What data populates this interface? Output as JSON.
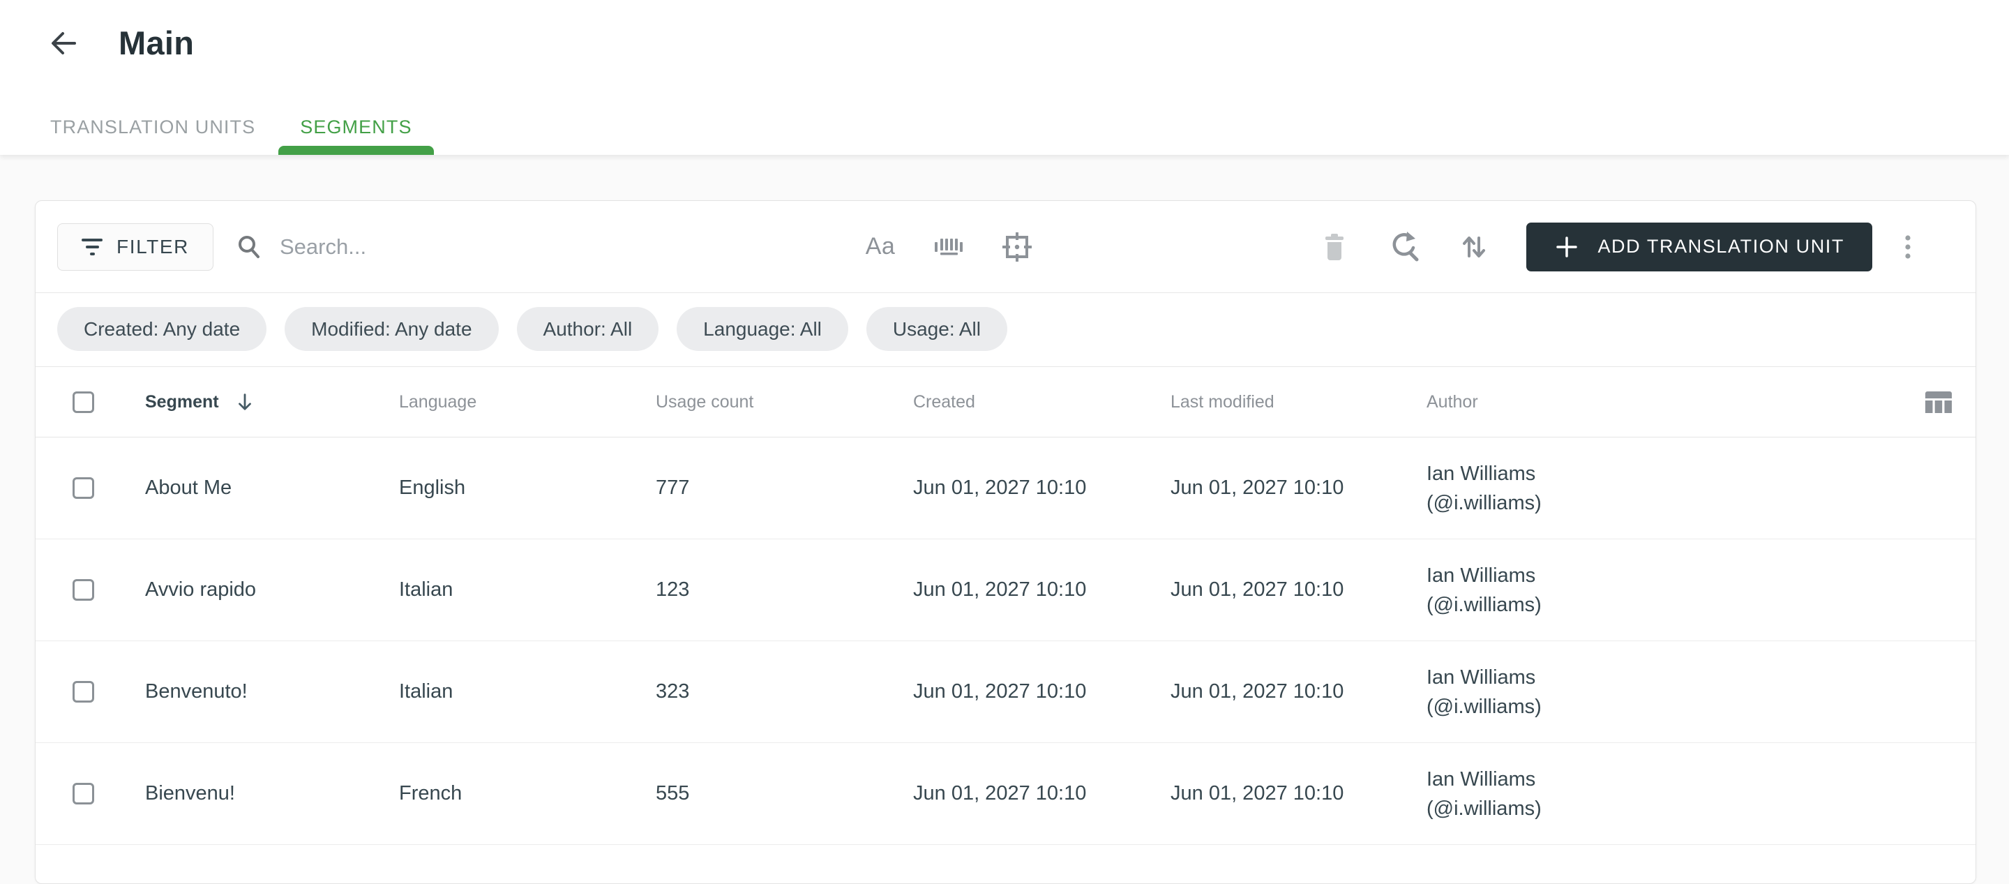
{
  "colors": {
    "accent_green": "#43a047",
    "dark_button": "#263238",
    "chip_background": "#ebecee"
  },
  "header": {
    "title": "Main"
  },
  "tabs": [
    {
      "label": "TRANSLATION UNITS",
      "active": false
    },
    {
      "label": "SEGMENTS",
      "active": true
    }
  ],
  "toolbar": {
    "filter_label": "FILTER",
    "search_placeholder": "Search...",
    "search_value": "",
    "match_case_label": "Aa",
    "add_button_label": "ADD TRANSLATION UNIT"
  },
  "filter_chips": [
    {
      "label": "Created: Any date"
    },
    {
      "label": "Modified: Any date"
    },
    {
      "label": "Author: All"
    },
    {
      "label": "Language: All"
    },
    {
      "label": "Usage: All"
    }
  ],
  "table": {
    "columns": {
      "segment": "Segment",
      "language": "Language",
      "usage_count": "Usage count",
      "created": "Created",
      "last_modified": "Last modified",
      "author": "Author"
    },
    "sort": {
      "column": "Segment",
      "direction": "desc"
    },
    "rows": [
      {
        "segment": "About Me",
        "language": "English",
        "usage_count": "777",
        "created": "Jun 01, 2027 10:10",
        "last_modified": "Jun 01, 2027 10:10",
        "author_name": "Ian Williams",
        "author_handle": "(@i.williams)"
      },
      {
        "segment": "Avvio rapido",
        "language": "Italian",
        "usage_count": "123",
        "created": "Jun 01, 2027 10:10",
        "last_modified": "Jun 01, 2027 10:10",
        "author_name": "Ian Williams",
        "author_handle": "(@i.williams)"
      },
      {
        "segment": "Benvenuto!",
        "language": "Italian",
        "usage_count": "323",
        "created": "Jun 01, 2027 10:10",
        "last_modified": "Jun 01, 2027 10:10",
        "author_name": "Ian Williams",
        "author_handle": "(@i.williams)"
      },
      {
        "segment": "Bienvenu!",
        "language": "French",
        "usage_count": "555",
        "created": "Jun 01, 2027 10:10",
        "last_modified": "Jun 01, 2027 10:10",
        "author_name": "Ian Williams",
        "author_handle": "(@i.williams)"
      }
    ]
  }
}
